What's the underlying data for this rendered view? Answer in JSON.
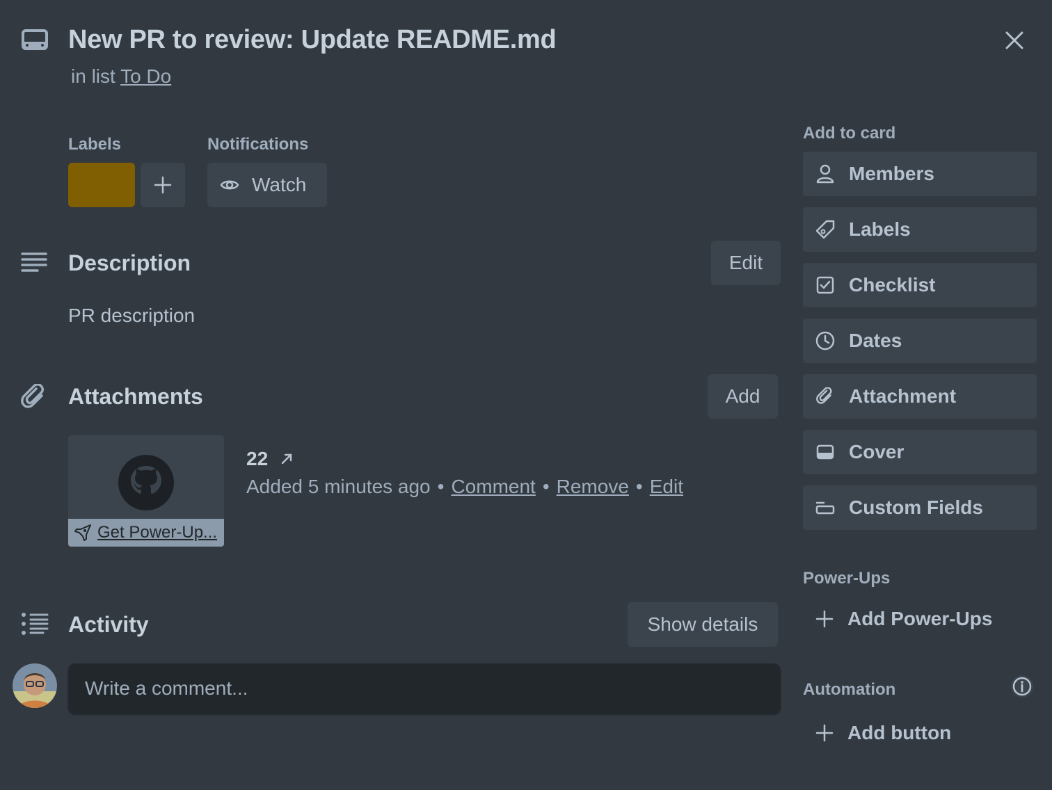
{
  "card": {
    "title": "New PR to review: Update README.md",
    "list_prefix": "in list",
    "list_name": "To Do"
  },
  "labels": {
    "caption": "Labels",
    "chip_color": "#7f5f01"
  },
  "notifications": {
    "caption": "Notifications",
    "watch_label": "Watch"
  },
  "description": {
    "title": "Description",
    "edit_label": "Edit",
    "text": "PR description"
  },
  "attachments": {
    "title": "Attachments",
    "add_label": "Add",
    "item": {
      "name": "22",
      "thumb_link": "Get Power-Up...",
      "added": "Added 5 minutes ago",
      "dot": "•",
      "comment_label": "Comment",
      "remove_label": "Remove",
      "edit_label": "Edit"
    }
  },
  "activity": {
    "title": "Activity",
    "show_details_label": "Show details",
    "comment_placeholder": "Write a comment..."
  },
  "sidebar": {
    "add_to_card_caption": "Add to card",
    "buttons": [
      {
        "label": "Members",
        "icon": "person-icon"
      },
      {
        "label": "Labels",
        "icon": "tag-icon"
      },
      {
        "label": "Checklist",
        "icon": "checkbox-icon"
      },
      {
        "label": "Dates",
        "icon": "clock-icon"
      },
      {
        "label": "Attachment",
        "icon": "paperclip-icon"
      },
      {
        "label": "Cover",
        "icon": "cover-icon"
      },
      {
        "label": "Custom Fields",
        "icon": "custom-fields-icon"
      }
    ],
    "powerups_caption": "Power-Ups",
    "add_powerups_label": "Add Power-Ups",
    "automation_caption": "Automation",
    "add_button_label": "Add button"
  },
  "colors": {
    "background": "#323940",
    "button": "#3b444c",
    "input": "#22272b",
    "label_chip": "#7f5f01"
  }
}
